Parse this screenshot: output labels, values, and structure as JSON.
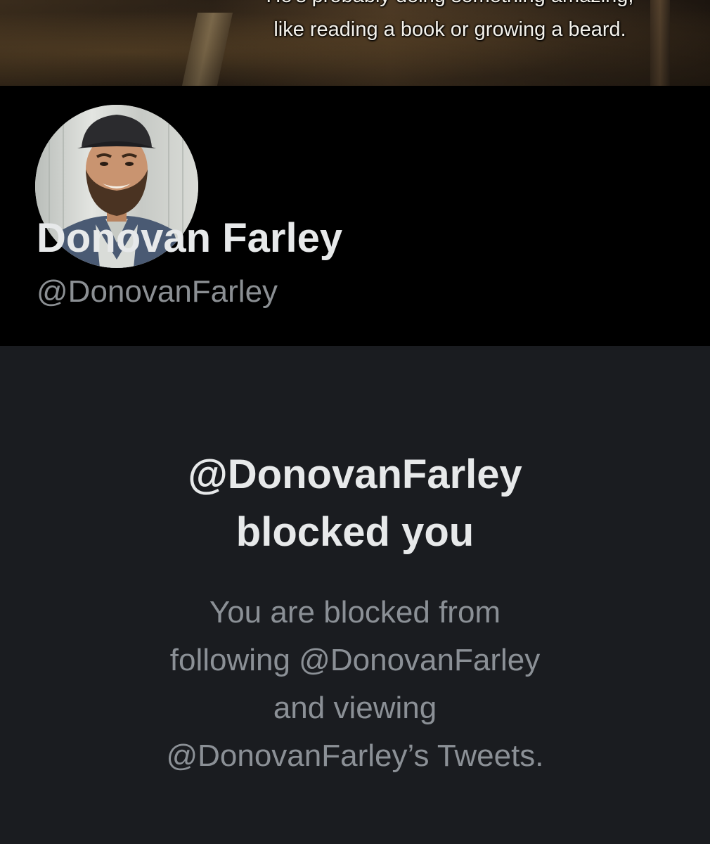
{
  "banner": {
    "caption_line1": "He's probably doing something amazing,",
    "caption_line2": "like reading a book or growing a beard."
  },
  "profile": {
    "display_name": "Donovan Farley",
    "handle": "@DonovanFarley",
    "avatar_icon": "profile-photo"
  },
  "blocked": {
    "title_line1": "@DonovanFarley",
    "title_line2": "blocked you",
    "body_line1": "You are blocked from",
    "body_line2": "following @DonovanFarley",
    "body_line3": "and viewing",
    "body_line4": "@DonovanFarley’s Tweets."
  },
  "colors": {
    "page_background": "#000000",
    "panel_background": "#1a1c20",
    "primary_text": "#e7e9ea",
    "secondary_text": "#8b9096"
  }
}
